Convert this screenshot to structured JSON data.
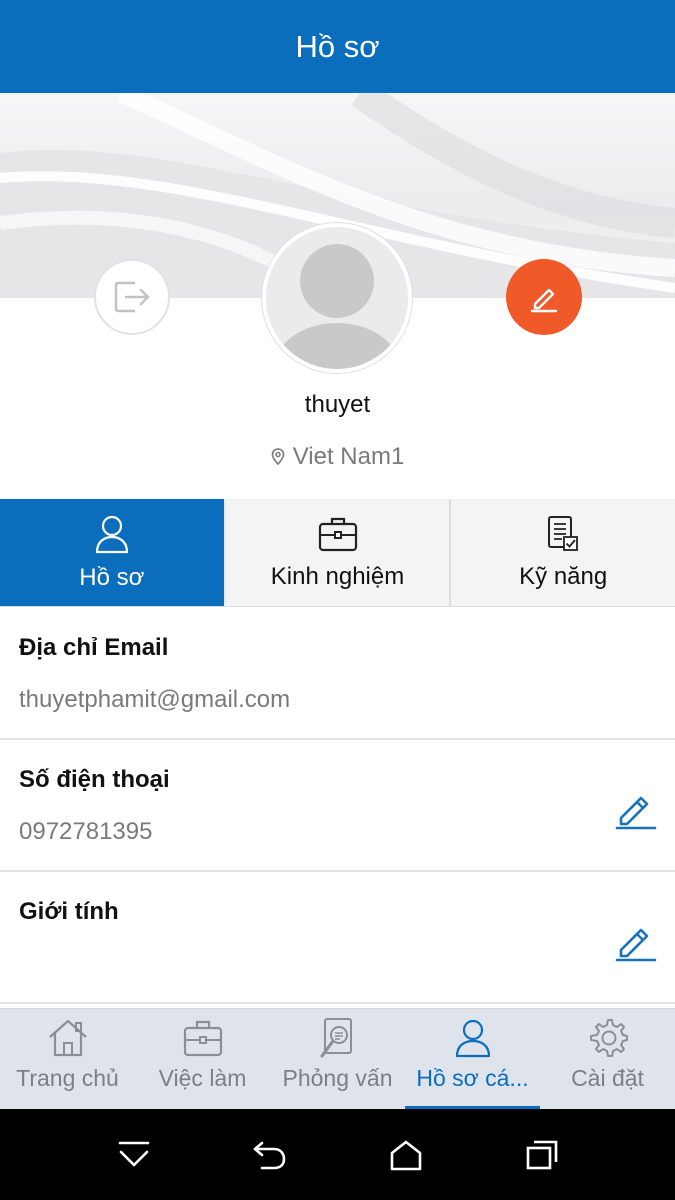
{
  "header": {
    "title": "Hồ sơ"
  },
  "profile": {
    "username": "thuyet",
    "location": "Viet Nam1"
  },
  "tabs": [
    {
      "label": "Hồ sơ",
      "icon": "person-icon",
      "active": true
    },
    {
      "label": "Kinh nghiệm",
      "icon": "briefcase-icon",
      "active": false
    },
    {
      "label": "Kỹ năng",
      "icon": "checklist-icon",
      "active": false
    }
  ],
  "info": [
    {
      "label": "Địa chỉ Email",
      "value": "thuyetphamit@gmail.com",
      "editable": false
    },
    {
      "label": "Số điện thoại",
      "value": "0972781395",
      "editable": true
    },
    {
      "label": "Giới tính",
      "value": "",
      "editable": true
    }
  ],
  "bottom_nav": [
    {
      "label": "Trang chủ",
      "icon": "home-icon",
      "active": false
    },
    {
      "label": "Việc làm",
      "icon": "briefcase-icon",
      "active": false
    },
    {
      "label": "Phỏng vấn",
      "icon": "interview-icon",
      "active": false
    },
    {
      "label": "Hồ sơ cá...",
      "icon": "person-icon",
      "active": true
    },
    {
      "label": "Cài đặt",
      "icon": "gear-icon",
      "active": false
    }
  ],
  "colors": {
    "primary": "#0a6ebd",
    "accent": "#f05a28",
    "nav_bg": "#dfe4ec",
    "muted_text": "#7a7a7a"
  }
}
